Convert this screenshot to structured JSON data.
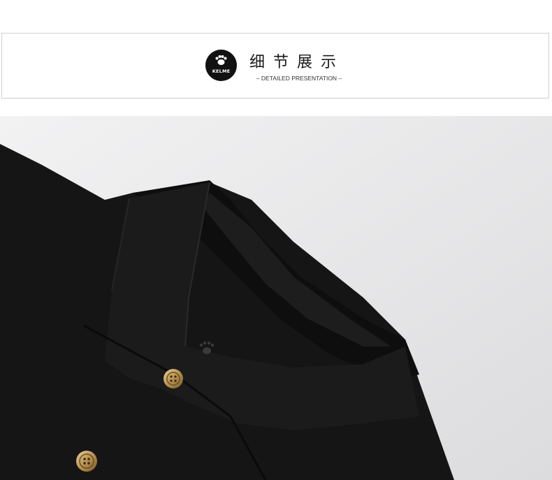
{
  "header": {
    "logo_text": "KELME",
    "title_cn": "细节展示",
    "title_en": "– DETAILED PRESENTATION –"
  },
  "colors": {
    "shirt": "#141414",
    "background": "#e9e9ea",
    "button_gold": "#c8a86a",
    "border": "#cfcfcf"
  },
  "photo": {
    "subject": "black polo shirt collar close-up with gold buttons",
    "icons": [
      "kelme-paw-icon"
    ]
  }
}
